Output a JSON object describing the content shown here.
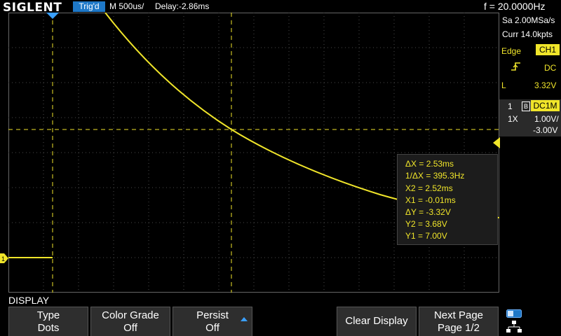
{
  "top": {
    "brand": "SIGLENT",
    "trigger_status": "Trig'd",
    "timebase": "M 500us/",
    "delay": "Delay:-2.86ms",
    "frequency": "f = 20.0000Hz"
  },
  "acquisition": {
    "sample_rate": "Sa 2.00MSa/s",
    "memory": "Curr 14.0kpts"
  },
  "trigger": {
    "type": "Edge",
    "source": "CH1",
    "slope_icon": "rising-edge-icon",
    "coupling": "DC",
    "level_label": "L",
    "level": "3.32V"
  },
  "channel": {
    "number": "1",
    "bw_flag": "B",
    "coupling": "DC1M",
    "probe": "1X",
    "volts_div": "1.00V/",
    "offset": "-3.00V"
  },
  "cursors": {
    "dx": "ΔX = 2.53ms",
    "inv_dx": "1/ΔX = 395.3Hz",
    "x2": "X2 = 2.52ms",
    "x1": "X1 = -0.01ms",
    "dy": "ΔY = -3.32V",
    "y2": "Y2 = 3.68V",
    "y1": "Y1 = 7.00V"
  },
  "menu": {
    "title": "DISPLAY",
    "softkeys": [
      {
        "label": "Type",
        "value": "Dots"
      },
      {
        "label": "Color Grade",
        "value": "Off"
      },
      {
        "label": "Persist",
        "value": "Off"
      },
      {
        "label": "Clear Display",
        "value": ""
      },
      {
        "label": "Next Page",
        "value": "Page 1/2"
      }
    ]
  },
  "colors": {
    "trace": "#f0e52a",
    "trigger_badge": "#1e78c8",
    "softkey_bg": "#2e2e2e",
    "grid": "#555555"
  }
}
